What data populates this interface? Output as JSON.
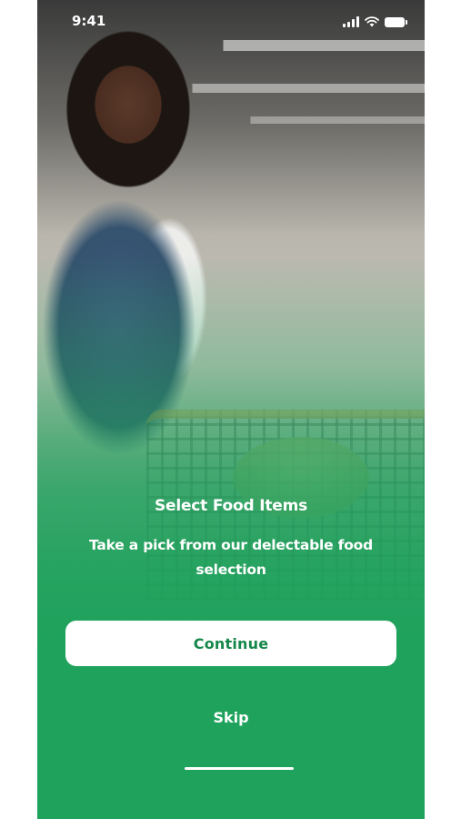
{
  "status_bar": {
    "time": "9:41",
    "icons": [
      "cellular-signal-icon",
      "wifi-icon",
      "battery-icon"
    ]
  },
  "onboarding": {
    "title": "Select Food Items",
    "subtitle": "Take a pick from our delectable food selection",
    "background_image": "woman-with-shopping-cart-in-supermarket",
    "continue_label": "Continue",
    "skip_label": "Skip"
  },
  "colors": {
    "brand_green": "#1ea25c",
    "button_text_green": "#14874a",
    "button_background": "#ffffff",
    "text_on_green": "#ffffff"
  }
}
